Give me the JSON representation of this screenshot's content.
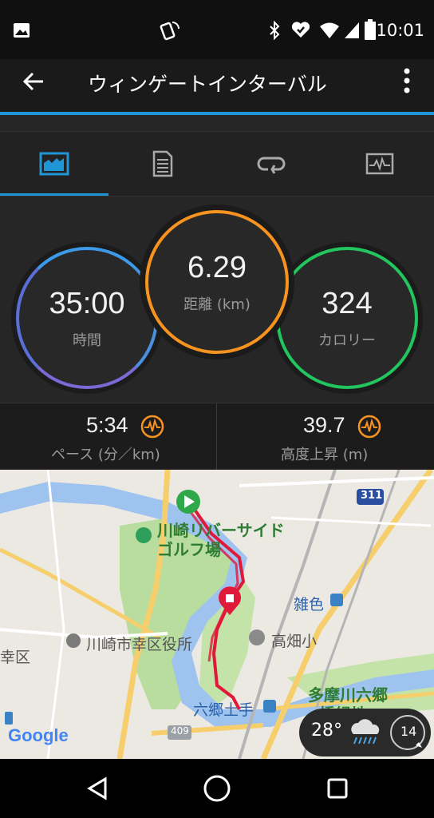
{
  "status_bar": {
    "time": "10:01"
  },
  "toolbar": {
    "title": "ウィンゲートインターバル"
  },
  "stats": {
    "time": {
      "value": "35:00",
      "label": "時間"
    },
    "distance": {
      "value": "6.29",
      "label": "距離 (km)"
    },
    "calories": {
      "value": "324",
      "label": "カロリー"
    }
  },
  "metrics": {
    "pace": {
      "value": "5:34",
      "label": "ペース (分／km)"
    },
    "elevation": {
      "value": "39.7",
      "label": "高度上昇 (m)"
    }
  },
  "map": {
    "labels": {
      "golf": "川崎リバーサイド\nゴルフ場",
      "ward_office": "川崎市幸区役所",
      "saiwai": "幸区",
      "zoshiki": "雑色",
      "takahata": "高畑小",
      "rokugo": "六郷土手",
      "tamagawa": "多摩川六郷",
      "tamagawa2": "橋緑地",
      "route311": "311",
      "route409": "409",
      "google": "Google"
    }
  },
  "weather": {
    "temp": "28°",
    "wind": "14"
  },
  "colors": {
    "accent": "#2196d6",
    "time_ring": "#4a8fe0",
    "distance_ring": "#f7931e",
    "calorie_ring": "#22c55e",
    "route": "#e0193a"
  }
}
